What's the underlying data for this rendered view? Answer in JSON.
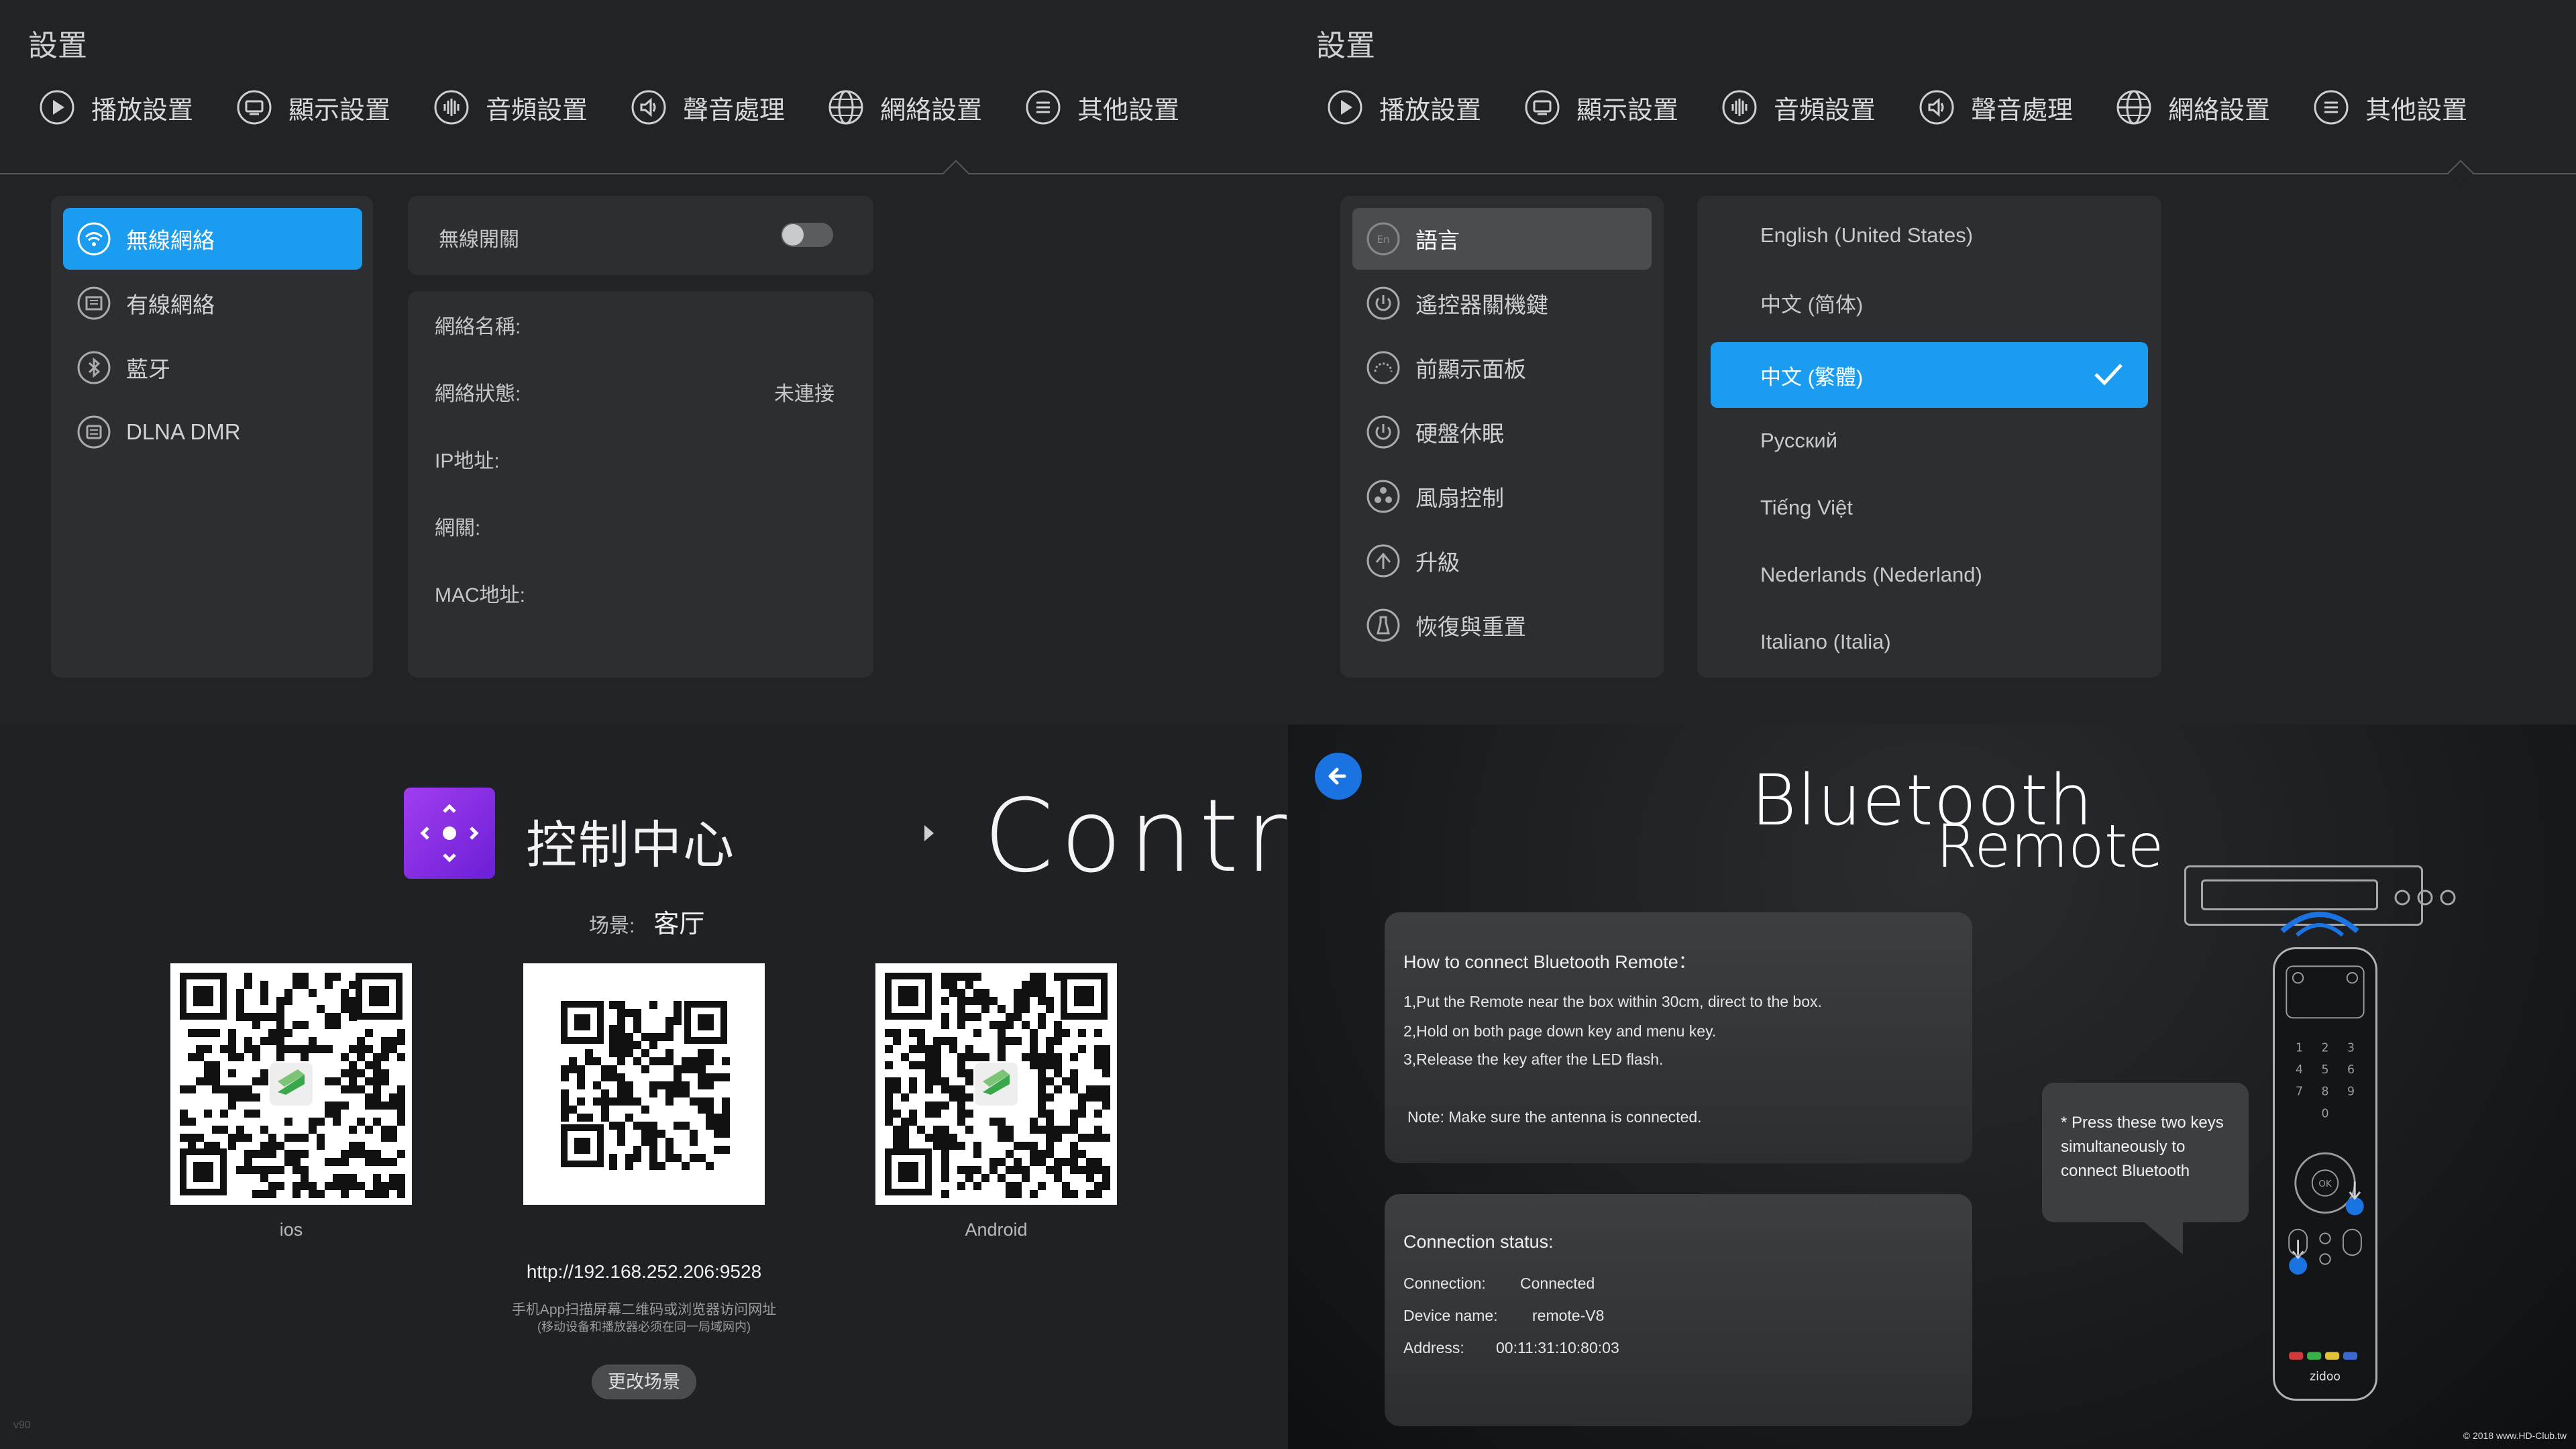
{
  "settings_network": {
    "title": "設置",
    "tabs": [
      "播放設置",
      "顯示設置",
      "音頻設置",
      "聲音處理",
      "網絡設置",
      "其他設置"
    ],
    "menu": [
      "無線網絡",
      "有線網絡",
      "藍牙",
      "DLNA DMR"
    ],
    "switch_label": "無線開關",
    "info": [
      {
        "label": "網絡名稱:",
        "value": ""
      },
      {
        "label": "網絡狀態:",
        "value": "未連接"
      },
      {
        "label": "IP地址:",
        "value": ""
      },
      {
        "label": "網關:",
        "value": ""
      },
      {
        "label": "MAC地址:",
        "value": ""
      }
    ]
  },
  "settings_other": {
    "title": "設置",
    "tabs": [
      "播放設置",
      "顯示設置",
      "音頻設置",
      "聲音處理",
      "網絡設置",
      "其他設置"
    ],
    "menu": [
      "語言",
      "遙控器關機鍵",
      "前顯示面板",
      "硬盤休眠",
      "風扇控制",
      "升級",
      "恢復與重置"
    ],
    "languages": [
      "English (United States)",
      "中文 (简体)",
      "中文 (繁體)",
      "Русский",
      "Tiếng Việt",
      "Nederlands (Nederland)",
      "Italiano (Italia)"
    ],
    "selected_language_index": 2
  },
  "control_center": {
    "title": "控制中心",
    "big_text": "Contro",
    "scene_label": "场景:",
    "scene_value": "客厅",
    "qr_labels": [
      "ios",
      "",
      "Android"
    ],
    "url": "http://192.168.252.206:9528",
    "hint_line1": "手机App扫描屏幕二维码或浏览器访问网址",
    "hint_line2": "(移动设备和播放器必须在同一局域网内)",
    "change_button": "更改场景",
    "version": "v90"
  },
  "bluetooth": {
    "title_main": "Bluetooth",
    "title_sub": "Remote",
    "how_title": "How to connect Bluetooth Remote：",
    "steps": [
      "1,Put the Remote near the box within 30cm, direct to the box.",
      "2,Hold on both page down key and menu key.",
      "3,Release the key after the LED flash."
    ],
    "note": "Note: Make sure the antenna is connected.",
    "status_title": "Connection status:",
    "connection_label": "Connection:",
    "connection_value": "Connected",
    "device_label": "Device name:",
    "device_value": "remote-V8",
    "address_label": "Address:",
    "address_value": "00:11:31:10:80:03",
    "bubble_text": "* Press these two keys simultaneously to connect Bluetooth",
    "remote_brand": "zidoo",
    "watermark": "© 2018 www.HD-Club.tw",
    "accent_color": "#1a9cf0"
  }
}
